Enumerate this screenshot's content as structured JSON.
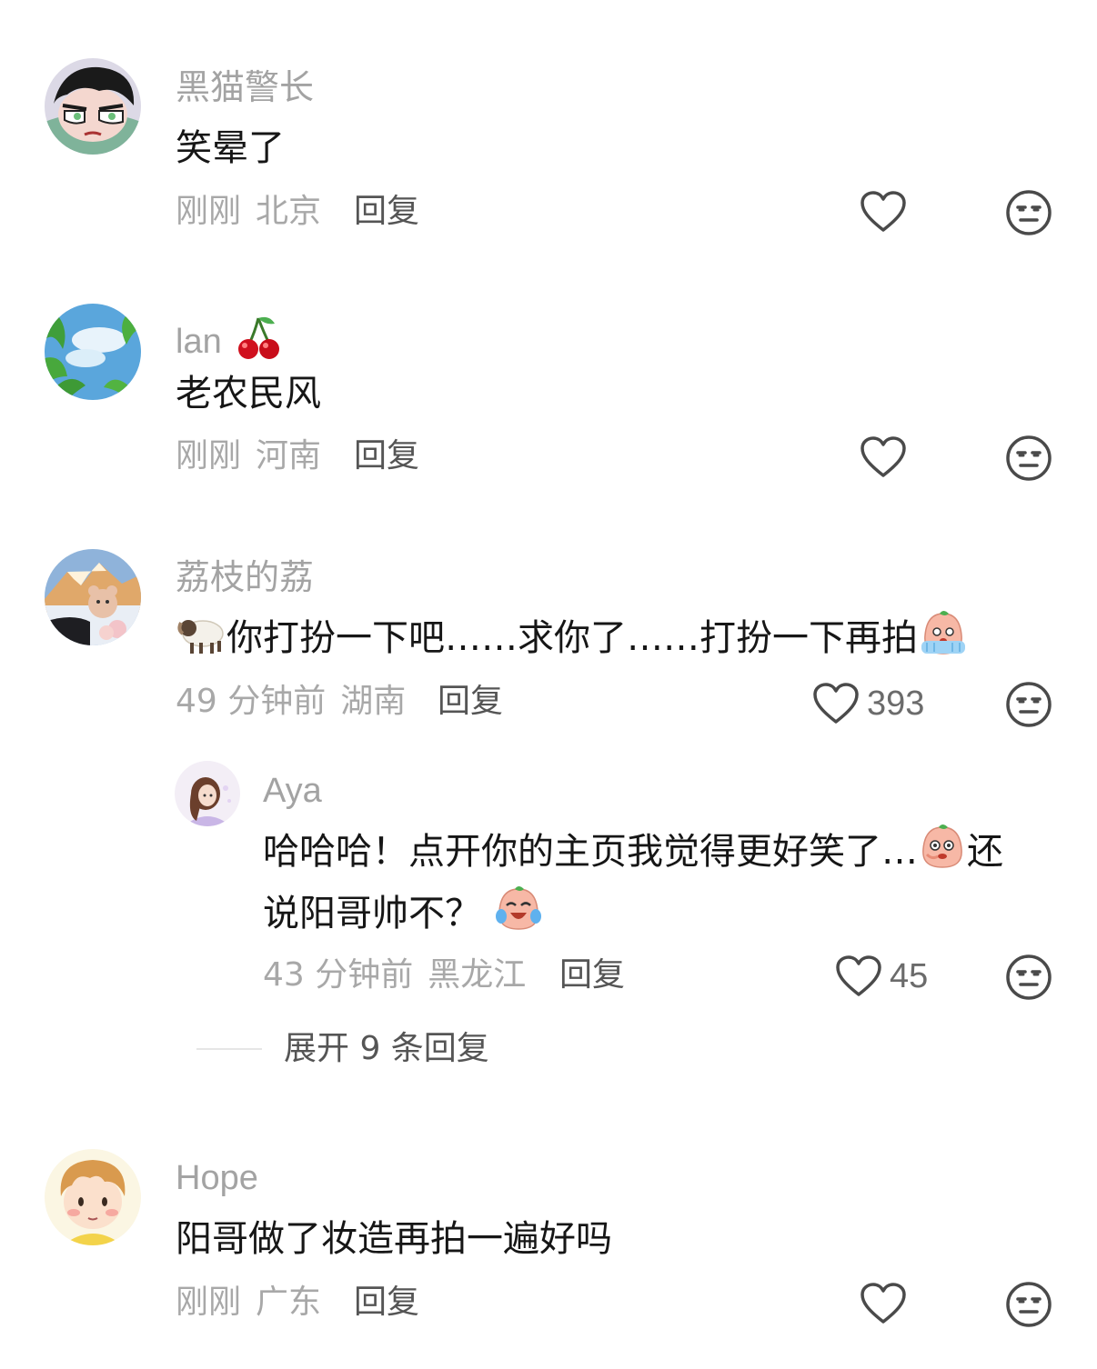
{
  "comments": [
    {
      "username": "黑猫警长",
      "content": "笑晕了",
      "time": "刚刚",
      "location": "北京",
      "reply_label": "回复",
      "avatar_icon": "cartoon-girl-avatar"
    },
    {
      "username": "lan",
      "username_emoji": "cherry-icon",
      "content": "老农民风",
      "time": "刚刚",
      "location": "河南",
      "reply_label": "回复",
      "avatar_icon": "sky-leaves-avatar"
    },
    {
      "username": "荔枝的荔",
      "content_prefix_emoji": "sheep-icon",
      "content": "你打扮一下吧……求你了……打扮一下再拍",
      "content_suffix_emoji": "begging-face-icon",
      "time": "49 分钟前",
      "location": "湖南",
      "reply_label": "回复",
      "like_count": "393",
      "avatar_icon": "mountain-bear-avatar",
      "sub_reply": {
        "username": "Aya",
        "content_line1": "哈哈哈！点开你的主页我觉得更好笑了…",
        "content_line1_end": "还",
        "content_line2": "说阳哥帅不？",
        "time": "43 分钟前",
        "location": "黑龙江",
        "reply_label": "回复",
        "like_count": "45",
        "avatar_icon": "anime-girl-avatar"
      },
      "expand_label": "展开 9 条回复"
    },
    {
      "username": "Hope",
      "content": "阳哥做了妆造再拍一遍好吗",
      "time": "刚刚",
      "location": "广东",
      "reply_label": "回复",
      "avatar_icon": "cartoon-boy-avatar"
    }
  ],
  "colors": {
    "username": "#a3a3a3",
    "content": "#161616",
    "meta": "#a8a8a8",
    "reply": "#555555",
    "icon_stroke": "#4a4a4a"
  }
}
